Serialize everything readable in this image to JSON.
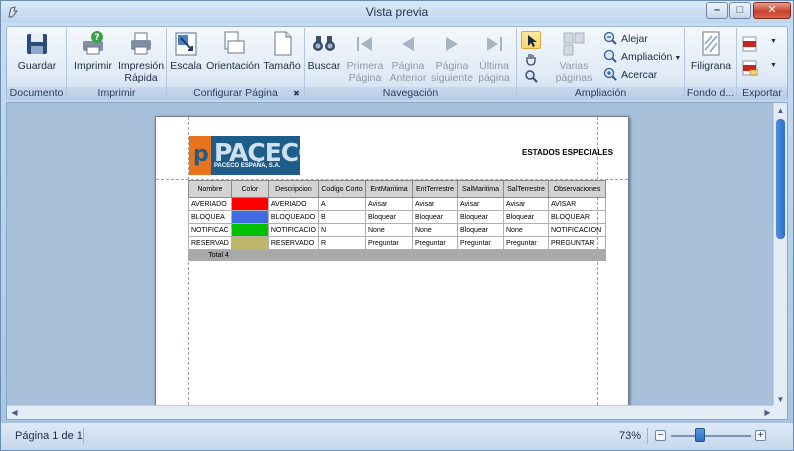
{
  "window": {
    "title": "Vista previa",
    "minimize_glyph": "–",
    "maximize_glyph": "□",
    "close_glyph": "✕"
  },
  "ribbon": {
    "groups": {
      "documento": {
        "label": "Documento",
        "buttons": [
          {
            "label": "Guardar",
            "icon": "save-icon"
          }
        ]
      },
      "imprimir": {
        "label": "Imprimir",
        "buttons": [
          {
            "label": "Imprimir",
            "icon": "print-icon"
          },
          {
            "label": "Impresión Rápida",
            "icon": "quick-print-icon"
          }
        ]
      },
      "configurar": {
        "label": "Configurar Página",
        "buttons": [
          {
            "label": "Escala",
            "icon": "scale-icon"
          },
          {
            "label": "Orientación",
            "icon": "orientation-icon"
          },
          {
            "label": "Tamaño",
            "icon": "page-size-icon"
          }
        ]
      },
      "navegacion": {
        "label": "Navegación",
        "buttons": [
          {
            "label": "Buscar",
            "icon": "binoculars-icon"
          },
          {
            "label": "Primera Página",
            "icon": "first-page-icon",
            "disabled": true
          },
          {
            "label": "Página Anterior",
            "icon": "previous-page-icon",
            "disabled": true
          },
          {
            "label": "Página siguiente",
            "icon": "next-page-icon",
            "disabled": true
          },
          {
            "label": "Última página",
            "icon": "last-page-icon",
            "disabled": true
          }
        ]
      },
      "ampliacion": {
        "label": "Ampliación",
        "buttons": [
          {
            "label": "Varias páginas",
            "icon": "multiple-pages-icon",
            "disabled": true
          },
          {
            "label": "Alejar",
            "icon": "zoom-out-icon"
          },
          {
            "label": "Ampliación",
            "icon": "zoom-icon"
          },
          {
            "label": "Acercar",
            "icon": "zoom-in-icon"
          }
        ]
      },
      "fondo": {
        "label": "Fondo d...",
        "buttons": [
          {
            "label": "Filigrana",
            "icon": "watermark-icon"
          }
        ]
      },
      "exportar": {
        "label": "Exportar",
        "buttons": [
          {
            "label": "",
            "icon": "pdf-export-icon"
          },
          {
            "label": "",
            "icon": "pdf-email-icon"
          }
        ]
      }
    }
  },
  "report": {
    "logo_text": "PACECO",
    "logo_letter": "p",
    "logo_subtitle": "PACECO ESPAÑA, S.A.",
    "title": "ESTADOS ESPECIALES",
    "columns": [
      "Nombre",
      "Color",
      "Descripcion",
      "Codigo Corto",
      "EntMaritima",
      "EntTerrestre",
      "SalMaritima",
      "SalTerrestre",
      "Observaciones"
    ],
    "rows": [
      {
        "nombre": "AVERIADO",
        "color": "#ff0000",
        "descripcion": "AVERIADO",
        "codigo": "A",
        "ent_maritima": "Avisar",
        "ent_terrestre": "Avisar",
        "sal_maritima": "Avisar",
        "sal_terrestre": "Avisar",
        "observaciones": "AVISAR"
      },
      {
        "nombre": "BLOQUEA",
        "color": "#4169e1",
        "descripcion": "BLOQUEADO",
        "codigo": "B",
        "ent_maritima": "Bloquear",
        "ent_terrestre": "Bloquear",
        "sal_maritima": "Bloquear",
        "sal_terrestre": "Bloquear",
        "observaciones": "BLOQUEAR"
      },
      {
        "nombre": "NOTIFICAC",
        "color": "#00c000",
        "descripcion": "NOTIFICACIO",
        "codigo": "N",
        "ent_maritima": "None",
        "ent_terrestre": "None",
        "sal_maritima": "Bloquear",
        "sal_terrestre": "None",
        "observaciones": "NOTIFICACION"
      },
      {
        "nombre": "RESERVAD",
        "color": "#bdb76b",
        "descripcion": "RESERVADO",
        "codigo": "R",
        "ent_maritima": "Preguntar",
        "ent_terrestre": "Preguntar",
        "sal_maritima": "Preguntar",
        "sal_terrestre": "Preguntar",
        "observaciones": "PREGUNTAR"
      }
    ],
    "total_label": "Total 4"
  },
  "statusbar": {
    "page_text": "Página 1 de 1",
    "zoom_text": "73%",
    "zoom_percent": 73
  }
}
